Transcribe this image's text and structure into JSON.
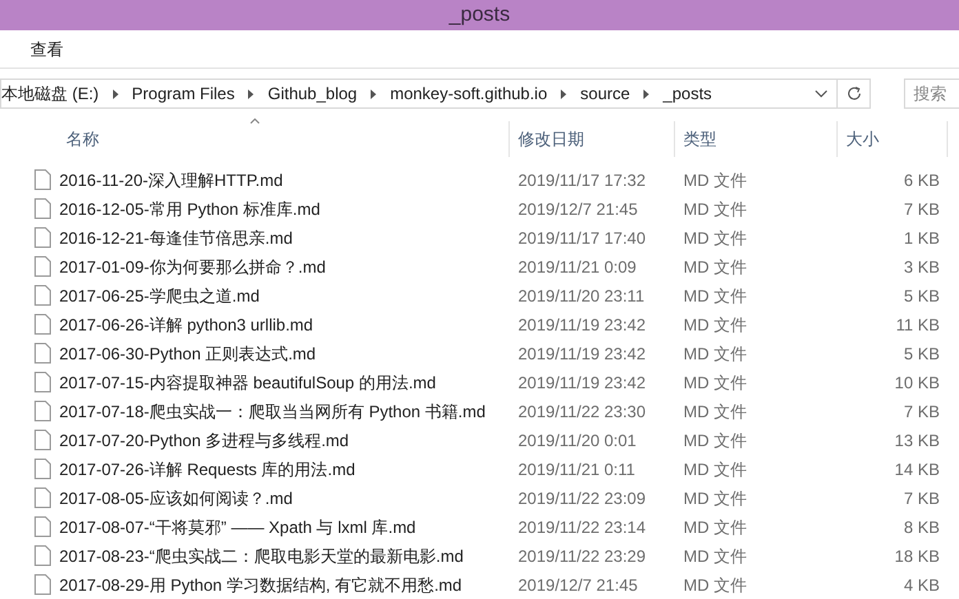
{
  "window": {
    "title": "_posts"
  },
  "menu": [
    "查看"
  ],
  "address": {
    "segments": [
      "本地磁盘 (E:)",
      "Program Files",
      "Github_blog",
      "monkey-soft.github.io",
      "source",
      "_posts"
    ]
  },
  "search": {
    "placeholder": "搜索"
  },
  "columns": [
    {
      "label": "名称",
      "sorted": true
    },
    {
      "label": "修改日期",
      "sorted": false
    },
    {
      "label": "类型",
      "sorted": false
    },
    {
      "label": "大小",
      "sorted": false
    }
  ],
  "rows": [
    {
      "name": "2016-11-20-深入理解HTTP.md",
      "modified": "2019/11/17 17:32",
      "type": "MD 文件",
      "size": "6 KB"
    },
    {
      "name": "2016-12-05-常用 Python 标准库.md",
      "modified": "2019/12/7 21:45",
      "type": "MD 文件",
      "size": "7 KB"
    },
    {
      "name": "2016-12-21-每逢佳节倍思亲.md",
      "modified": "2019/11/17 17:40",
      "type": "MD 文件",
      "size": "1 KB"
    },
    {
      "name": "2017-01-09-你为何要那么拼命？.md",
      "modified": "2019/11/21 0:09",
      "type": "MD 文件",
      "size": "3 KB"
    },
    {
      "name": "2017-06-25-学爬虫之道.md",
      "modified": "2019/11/20 23:11",
      "type": "MD 文件",
      "size": "5 KB"
    },
    {
      "name": "2017-06-26-详解 python3 urllib.md",
      "modified": "2019/11/19 23:42",
      "type": "MD 文件",
      "size": "11 KB"
    },
    {
      "name": "2017-06-30-Python 正则表达式.md",
      "modified": "2019/11/19 23:42",
      "type": "MD 文件",
      "size": "5 KB"
    },
    {
      "name": "2017-07-15-内容提取神器 beautifulSoup 的用法.md",
      "modified": "2019/11/19 23:42",
      "type": "MD 文件",
      "size": "10 KB"
    },
    {
      "name": "2017-07-18-爬虫实战一：爬取当当网所有 Python 书籍.md",
      "modified": "2019/11/22 23:30",
      "type": "MD 文件",
      "size": "7 KB"
    },
    {
      "name": "2017-07-20-Python 多进程与多线程.md",
      "modified": "2019/11/20 0:01",
      "type": "MD 文件",
      "size": "13 KB"
    },
    {
      "name": "2017-07-26-详解 Requests 库的用法.md",
      "modified": "2019/11/21 0:11",
      "type": "MD 文件",
      "size": "14 KB"
    },
    {
      "name": "2017-08-05-应该如何阅读？.md",
      "modified": "2019/11/22 23:09",
      "type": "MD 文件",
      "size": "7 KB"
    },
    {
      "name": "2017-08-07-“干将莫邪” —— Xpath 与 lxml 库.md",
      "modified": "2019/11/22 23:14",
      "type": "MD 文件",
      "size": "8 KB"
    },
    {
      "name": "2017-08-23-“爬虫实战二：爬取电影天堂的最新电影.md",
      "modified": "2019/11/22 23:29",
      "type": "MD 文件",
      "size": "18 KB"
    },
    {
      "name": "2017-08-29-用 Python 学习数据结构, 有它就不用愁.md",
      "modified": "2019/12/7 21:45",
      "type": "MD 文件",
      "size": "4 KB"
    }
  ]
}
